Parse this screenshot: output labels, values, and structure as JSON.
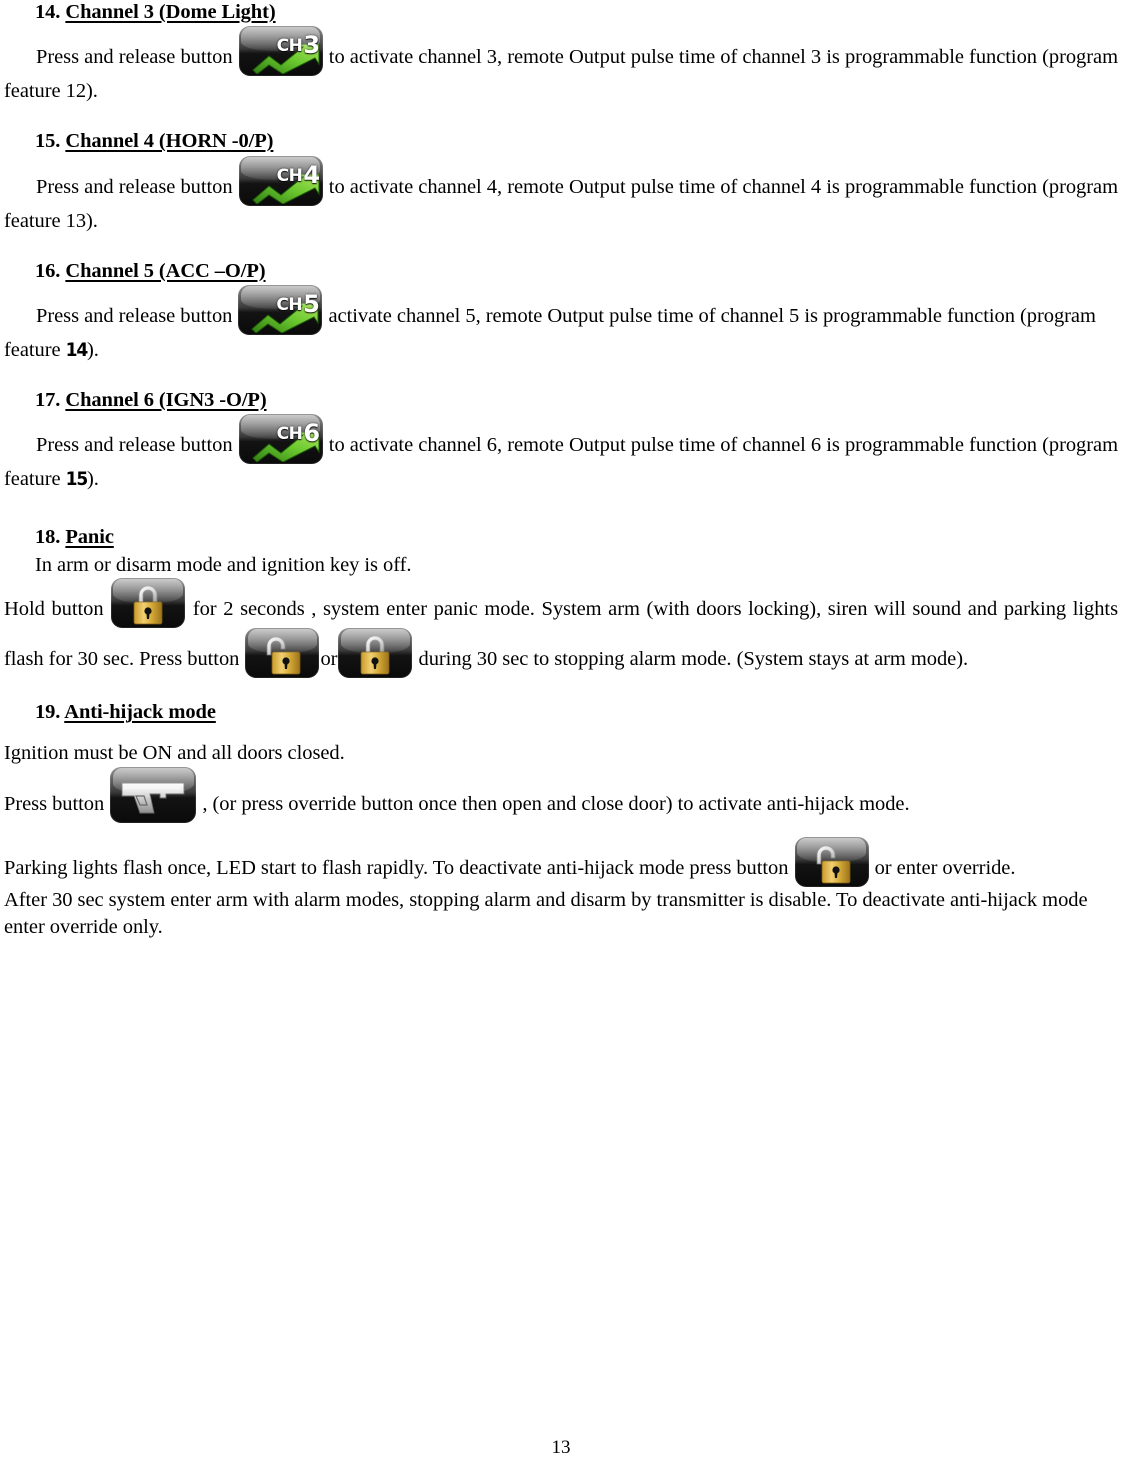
{
  "document": {
    "page_number": "13",
    "sections": [
      {
        "id": "sec14",
        "number": "14.",
        "title": "Channel 3 (Dome Light)",
        "icon": "ch3-button-icon",
        "icon_label_prefix": "CH",
        "icon_label_number": "3",
        "body_before_icon": "Press and release button ",
        "body_after_icon": " to activate channel 3, remote Output pulse time of channel 3 is programmable function (program feature  12).",
        "feature_number": "12"
      },
      {
        "id": "sec15",
        "number": "15.",
        "title": "Channel 4 (HORN -0/P)",
        "icon": "ch4-button-icon",
        "icon_label_prefix": "CH",
        "icon_label_number": "4",
        "body_before_icon": "Press and release button ",
        "body_after_icon": " to activate channel 4, remote Output pulse time of channel 4 is programmable function (program feature  13).",
        "feature_number": "13"
      },
      {
        "id": "sec16",
        "number": "16.",
        "title": "Channel 5 (ACC –O/P)",
        "icon": "ch5-button-icon",
        "icon_label_prefix": "CH",
        "icon_label_number": "5",
        "body_before_icon": "Press and release button ",
        "body_after_icon_1": " activate channel 5, remote Output pulse time of channel 5 is programmable function (program feature  ",
        "feature_number": "14",
        "body_after_icon_2": ")."
      },
      {
        "id": "sec17",
        "number": "17.",
        "title": "Channel 6 (IGN3 -O/P)",
        "icon": "ch6-button-icon",
        "icon_label_prefix": "CH",
        "icon_label_number": "6",
        "body_before_icon": "Press and release button ",
        "body_after_icon_1": " to activate channel 6, remote Output pulse time of channel 6 is programmable function (program feature  ",
        "feature_number": "15",
        "body_after_icon_2": ")."
      },
      {
        "id": "sec18",
        "number": "18.",
        "title": "Panic",
        "line1": "In arm or disarm mode and ignition key is off.",
        "line2_before_icon": "Hold button  ",
        "line2_after_icon": " for 2 seconds , system enter panic mode. System arm (with doors locking), siren will sound and parking lights flash for 30 sec. Press button ",
        "line2_mid": "or",
        "line2_end": " during 30 sec to stopping alarm mode. (System stays at arm mode).",
        "icon_lock": "lock-button-icon",
        "icon_unlock": "unlock-button-icon"
      },
      {
        "id": "sec19",
        "number": "19.",
        "title": "Anti-hijack mode",
        "line1": "Ignition must be ON and all doors closed.",
        "line2_before_icon": "Press button ",
        "line2_after_icon": " ,  (or press override button once then open and close door) to activate anti-hijack mode.",
        "line3_before_icon": "Parking lights flash once, LED start to flash rapidly. To deactivate anti-hijack mode press button ",
        "line3_after_icon": " or enter override.",
        "line4": "After 30 sec system enter arm with alarm modes, stopping alarm and disarm by transmitter is disable. To deactivate anti-hijack mode enter override only.",
        "icon_gun": "gun-button-icon",
        "icon_unlock": "unlock-button-icon"
      }
    ]
  },
  "colors": {
    "text": "#000000",
    "page_background": "#ffffff",
    "icon_body_dark": "#0a0a0a",
    "icon_body_light": "#8d8d8d",
    "arrow_green": "#5cb82a",
    "arrow_green_dark": "#2f7d12",
    "padlock_gold": "#e0b43c",
    "padlock_gold_dark": "#9c7418",
    "shackle_silver": "#e8e8e8",
    "gun_silver": "#d8d8d8"
  }
}
